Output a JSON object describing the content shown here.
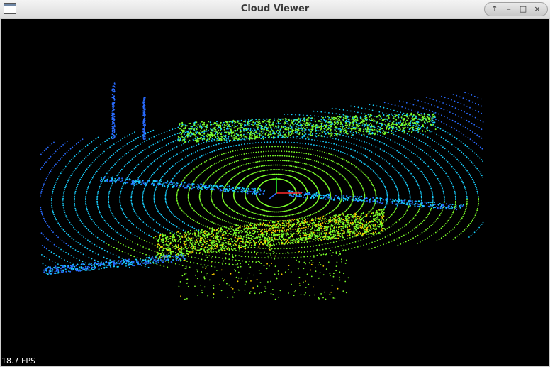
{
  "window": {
    "title": "Cloud Viewer",
    "controls": {
      "shade_icon": "arrow-up-icon",
      "minimize_icon": "minimize-icon",
      "maximize_icon": "maximize-icon",
      "close_icon": "close-icon"
    }
  },
  "viewer": {
    "fps_text": "18.7 FPS",
    "colors": {
      "background": "#000000",
      "low": "#2a6cff",
      "mid": "#19d0ff",
      "high": "#7cff2a",
      "top": "#ffd400",
      "axis_x": "#ff2a2a",
      "axis_y": "#2aff2a",
      "axis_z": "#2a6cff"
    }
  }
}
